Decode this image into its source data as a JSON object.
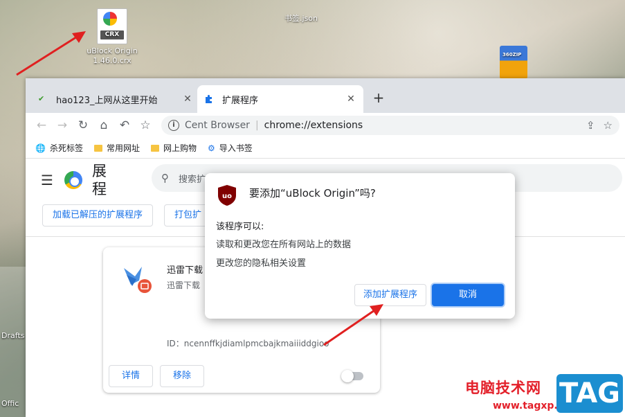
{
  "desktop": {
    "crx_icon": {
      "badge": "CRX",
      "label_line1": "uBlock Origin",
      "label_line2": "1.46.0.crx"
    },
    "json_icon": {
      "label": "书签.json"
    },
    "zip_icon": {
      "badge": "360ZIP"
    },
    "left_labels": [
      "Drafts",
      "Offic"
    ]
  },
  "browser": {
    "tabs": [
      {
        "title": "hao123_上网从这里开始",
        "favicon": "hao123-icon",
        "active": false
      },
      {
        "title": "扩展程序",
        "favicon": "puzzle-icon",
        "active": true
      }
    ],
    "new_tab": "+",
    "close_glyph": "✕",
    "omnibox": {
      "site": "Cent Browser",
      "url": "chrome://extensions"
    },
    "bookmarks": [
      {
        "label": "杀死标签",
        "icon": "globe-icon"
      },
      {
        "label": "常用网址",
        "icon": "folder-icon"
      },
      {
        "label": "网上购物",
        "icon": "folder-icon"
      },
      {
        "label": "导入书签",
        "icon": "gear-icon"
      }
    ]
  },
  "extensions_page": {
    "title": "扩展程序",
    "title_lines": [
      "展",
      "程"
    ],
    "search_placeholder": "搜索扩展程序",
    "actions": [
      "加载已解压的扩展程序",
      "打包扩"
    ],
    "card": {
      "name": "迅雷下载",
      "description": "迅雷下载",
      "id_label": "ID：ncennffkjdiamlpmcbajkmaiiiddgioo",
      "details_button": "详情",
      "remove_button": "移除",
      "enabled": false
    }
  },
  "dialog": {
    "title": "要添加“uBlock Origin”吗?",
    "permissions_heading": "该程序可以:",
    "permissions": [
      "读取和更改您在所有网站上的数据",
      "更改您的隐私相关设置"
    ],
    "add_button": "添加扩展程序",
    "cancel_button": "取消"
  },
  "watermark": {
    "text": "电脑技术网",
    "url": "www.tagxp.com",
    "tag": "TAG"
  },
  "colors": {
    "accent": "#1a73e8",
    "ublock": "#800000",
    "arrow": "#e02020",
    "watermark_red": "#e3202a"
  }
}
